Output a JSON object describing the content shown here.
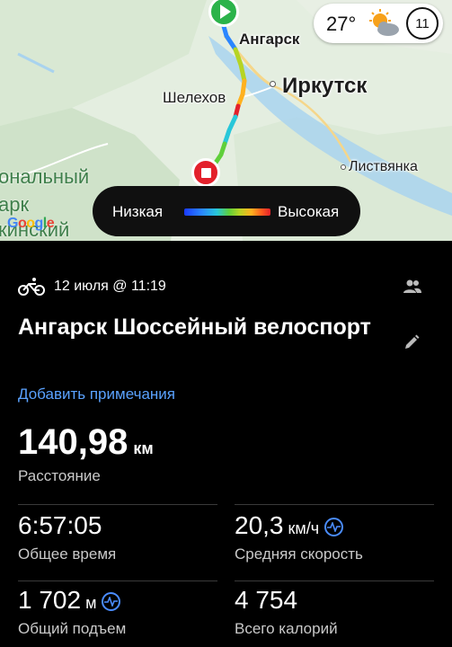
{
  "map": {
    "labels": {
      "angarsk": "Ангарск",
      "irkutsk": "Иркутск",
      "shelekhov": "Шелехов",
      "listvyanka": "Листвянка",
      "park_line1": "ональный",
      "park_line2": "арк",
      "park_line3": "кинский"
    },
    "google_logo": [
      "G",
      "o",
      "o",
      "g",
      "l",
      "e"
    ],
    "weather": {
      "temperature": "27°",
      "icon": "sun-cloud-icon",
      "aqi": "11"
    },
    "legend": {
      "low_label": "Низкая",
      "high_label": "Высокая"
    },
    "markers": {
      "start": "play-icon",
      "end": "stop-icon"
    }
  },
  "activity": {
    "type_icon": "bike-icon",
    "date": "12 июля @ 11:19",
    "title": "Ангарск Шоссейный велоспорт",
    "add_notes": "Добавить примечания",
    "distance": {
      "value": "140,98",
      "unit": "км",
      "label": "Расстояние"
    },
    "stats": {
      "total_time": {
        "value": "6:57:05",
        "label": "Общее время"
      },
      "avg_speed": {
        "value": "20,3",
        "unit": "км/ч",
        "label": "Средняя скорость"
      },
      "elevation": {
        "value": "1 702",
        "unit": "м",
        "label": "Общий подъем"
      },
      "calories": {
        "value": "4 754",
        "label": "Всего калорий"
      }
    }
  },
  "colors": {
    "accent_link": "#5aa2ff",
    "start_marker": "#2bb34a",
    "end_marker": "#e3202b",
    "background": "#000000"
  }
}
